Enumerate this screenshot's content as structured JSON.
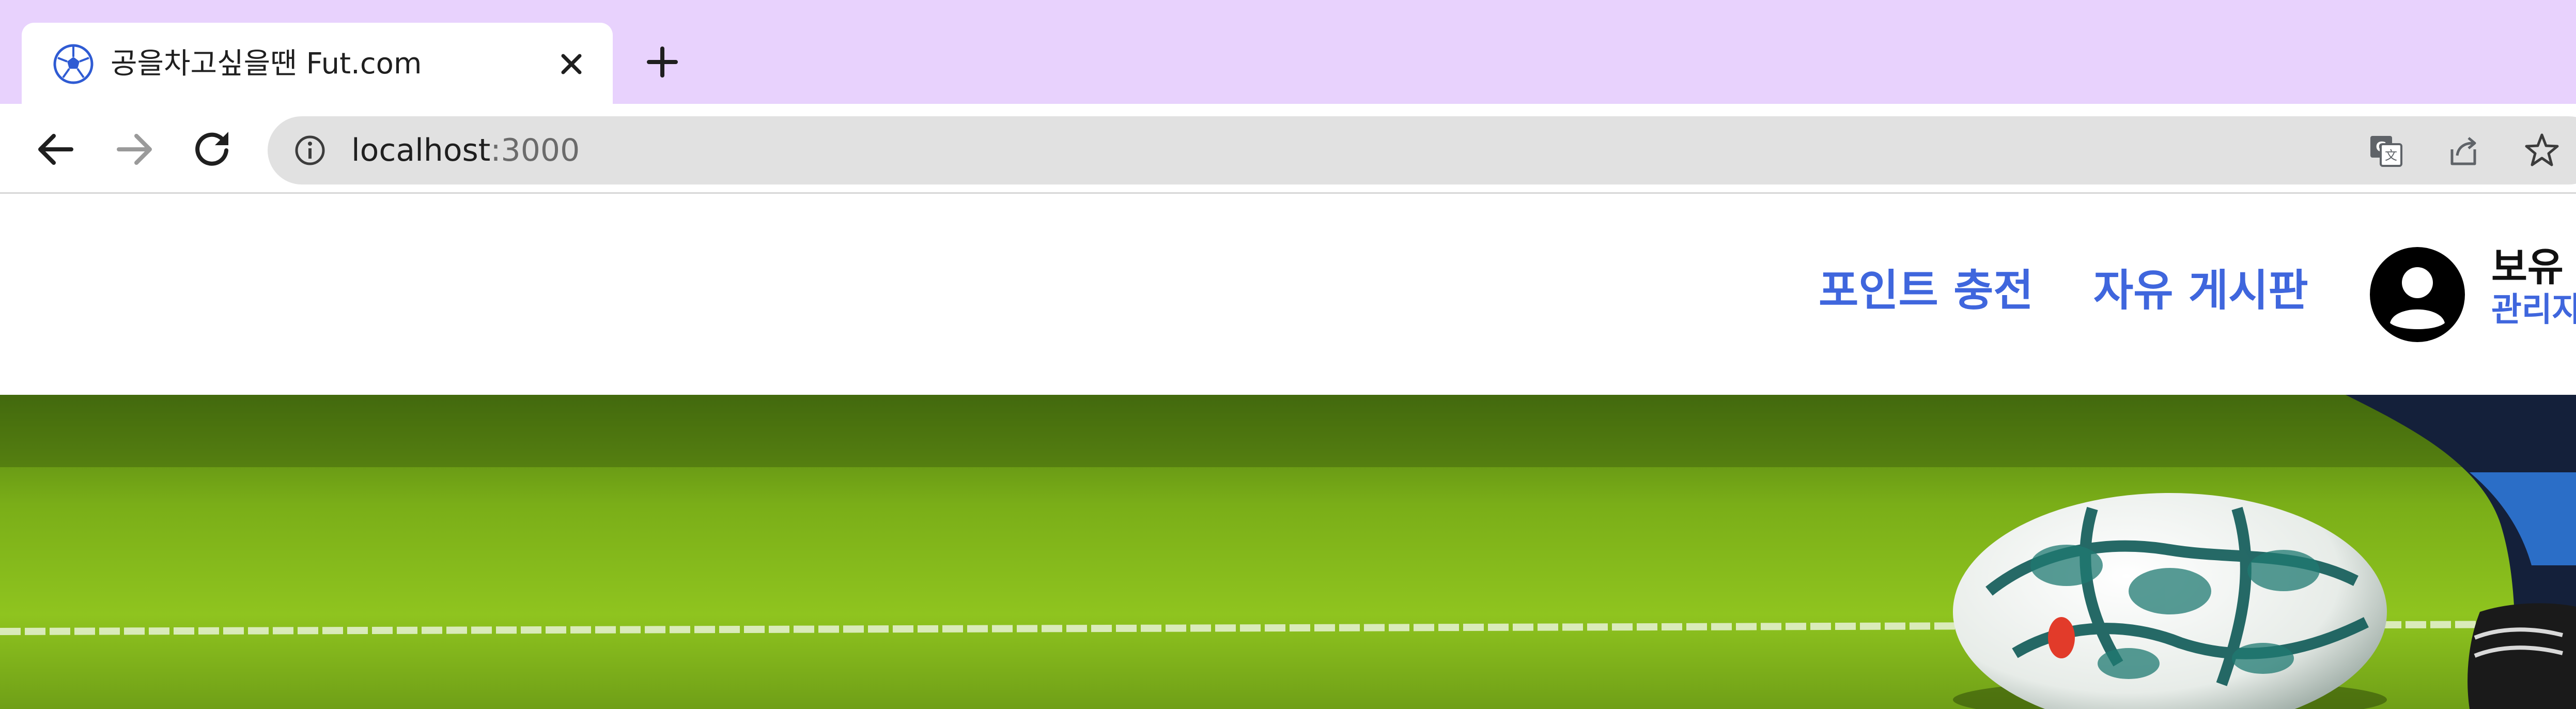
{
  "browser": {
    "tab": {
      "title": "공을차고싶을땐 Fut.com",
      "favicon": "soccer-ball-icon",
      "close_icon": "close-icon"
    },
    "new_tab_icon": "plus-icon",
    "nav": {
      "back_icon": "arrow-left-icon",
      "forward_icon": "arrow-right-icon",
      "reload_icon": "reload-icon"
    },
    "address_bar": {
      "host": "localhost",
      "port": ":3000",
      "info_icon": "info-icon",
      "actions": [
        "translate-icon",
        "share-icon",
        "star-icon"
      ]
    },
    "colors": {
      "tabstrip": "#e8d2fd",
      "omnibox": "#e1e1e1"
    }
  },
  "header": {
    "nav": [
      {
        "label": "포인트 충전"
      },
      {
        "label": "자유 게시판"
      }
    ],
    "user": {
      "avatar_icon": "user-avatar-icon",
      "points_label": "보유 포",
      "role_label": "관리자"
    },
    "colors": {
      "link": "#3f66dd"
    }
  },
  "hero": {
    "image": "soccer-ball-on-grass-banner"
  }
}
